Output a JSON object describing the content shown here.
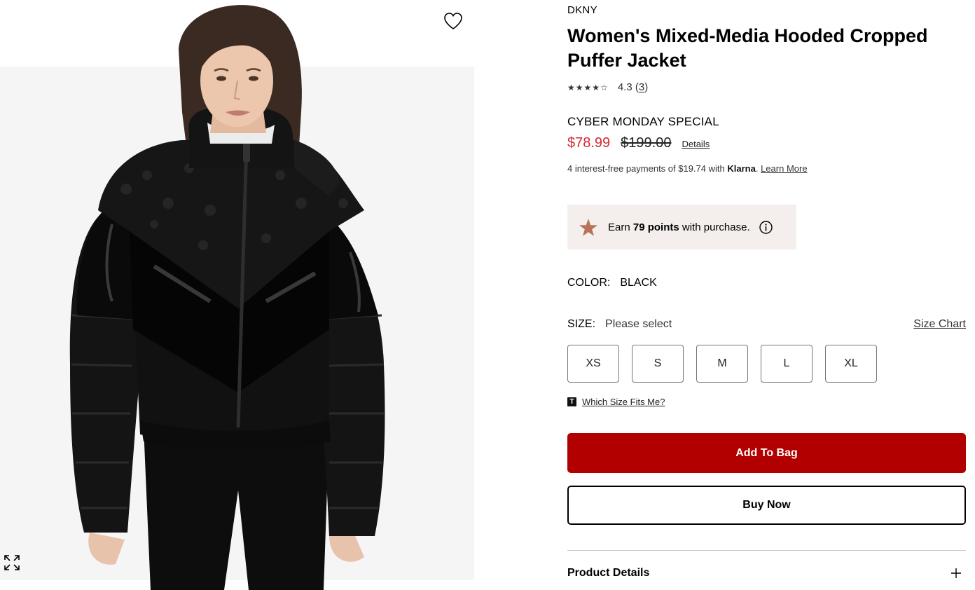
{
  "product": {
    "brand": "DKNY",
    "title": "Women's Mixed-Media Hooded Cropped Puffer Jacket",
    "rating": {
      "stars": 4.3,
      "value": "4.3",
      "count": "3"
    },
    "promo_label": "CYBER MONDAY SPECIAL",
    "price": {
      "sale": "$78.99",
      "original": "$199.00",
      "details_link": "Details"
    },
    "klarna": {
      "prefix": "4 interest-free payments of $19.74 with",
      "brand": "Klarna",
      "dot": ".",
      "learn_more": "Learn More"
    },
    "points": {
      "earn": "Earn",
      "amount": "79 points",
      "suffix": "with purchase."
    },
    "color": {
      "label": "COLOR:",
      "value": "BLACK"
    },
    "size": {
      "label": "SIZE:",
      "placeholder": "Please select",
      "chart_link": "Size Chart",
      "options": [
        "XS",
        "S",
        "M",
        "L",
        "XL"
      ],
      "fit_logo": "T",
      "fit_link": "Which Size Fits Me?"
    },
    "actions": {
      "add_to_bag": "Add To Bag",
      "buy_now": "Buy Now"
    },
    "accordion": {
      "product_details": "Product Details"
    }
  },
  "icons": {
    "favorite": "heart-icon",
    "expand": "expand-icon",
    "points": "star-icon",
    "info": "info-icon",
    "accordion": "plus-icon"
  },
  "colors": {
    "sale_price": "#d12a2f",
    "add_to_bag": "#b20000",
    "points_bg": "#f4efed",
    "points_star": "#b8735a"
  }
}
